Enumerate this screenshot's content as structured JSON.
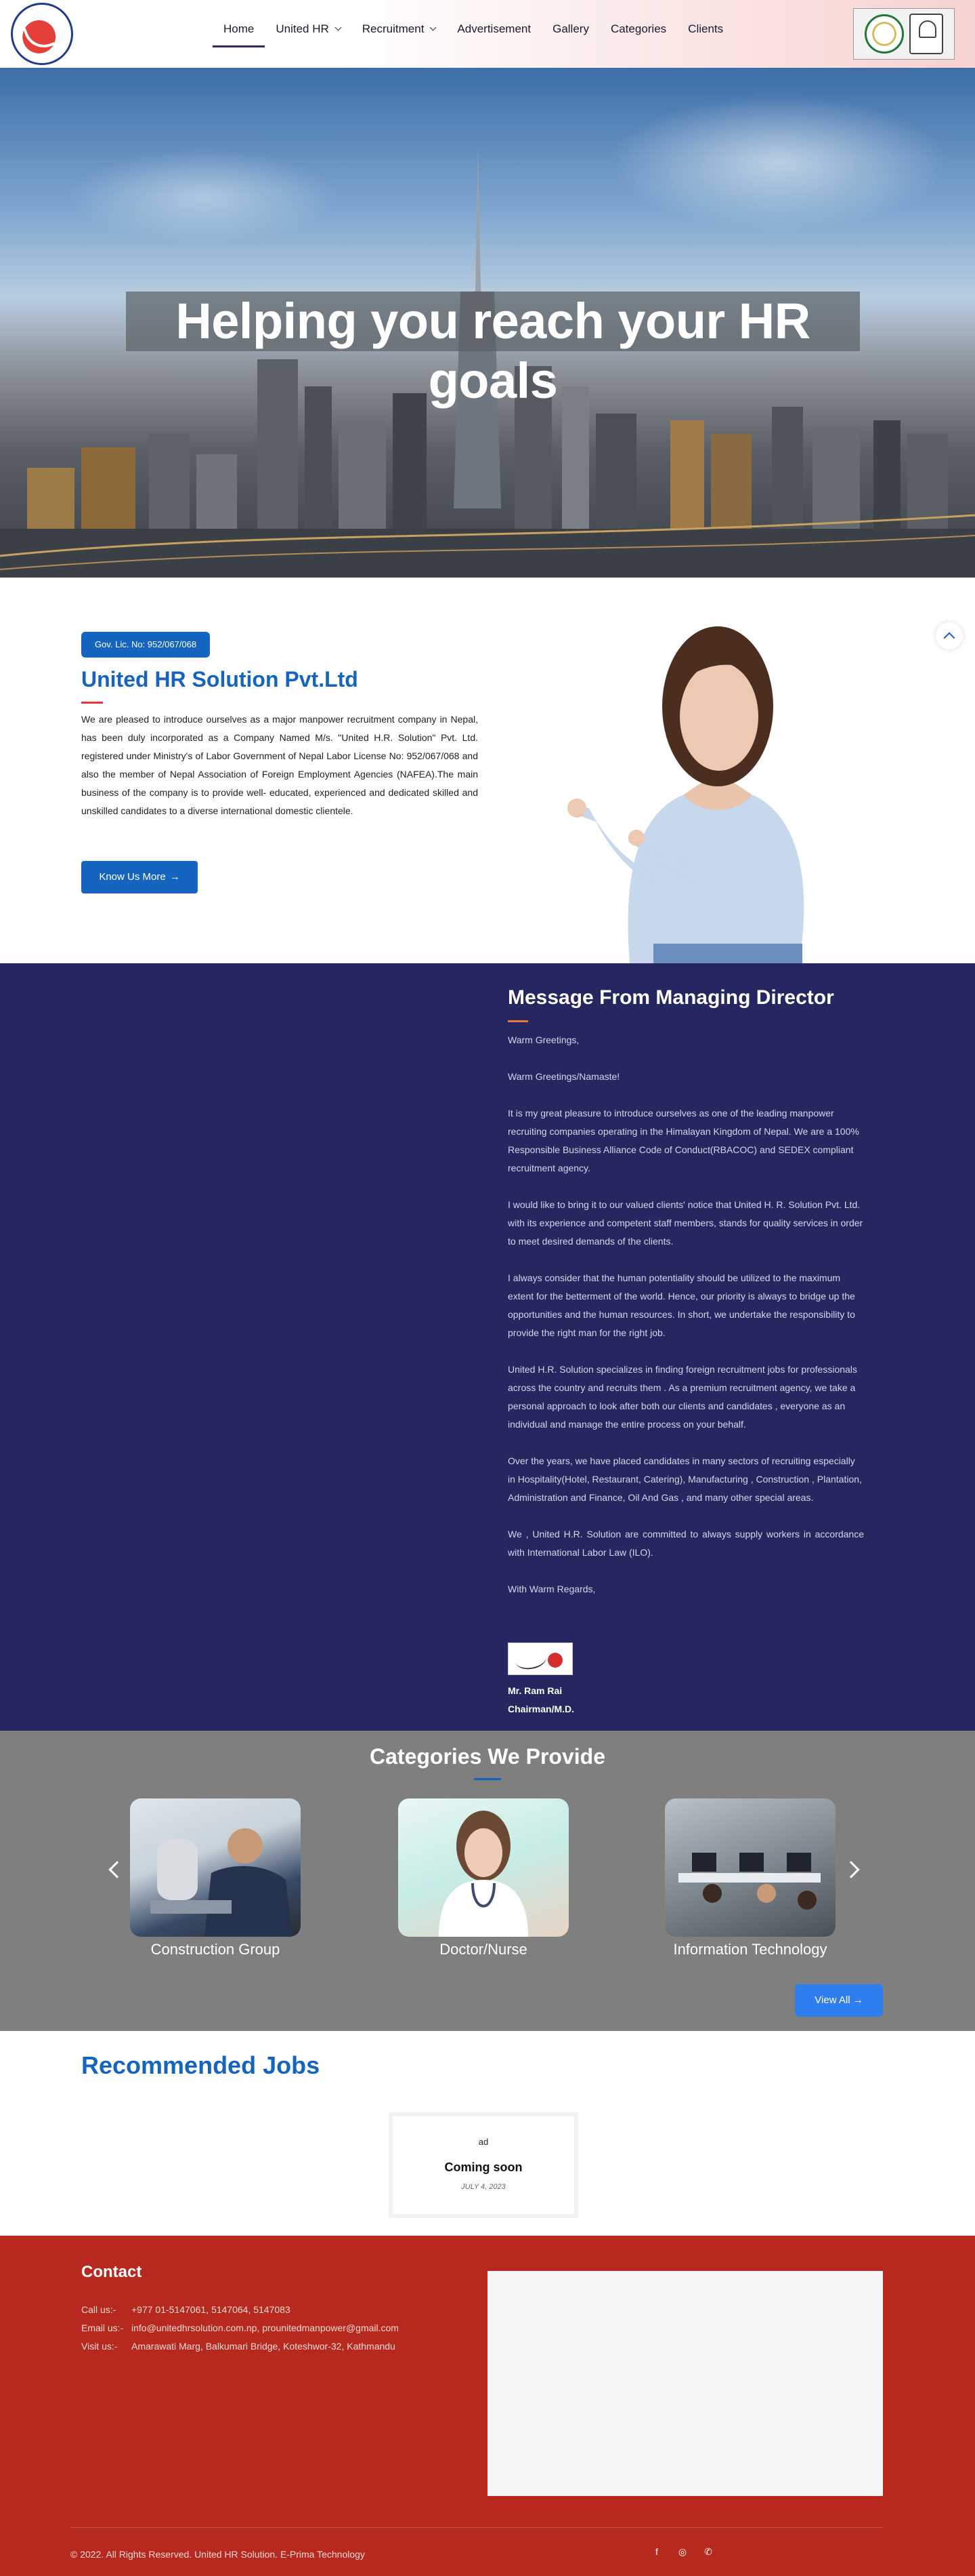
{
  "nav": {
    "items": [
      {
        "label": "Home",
        "active": true,
        "dropdown": false
      },
      {
        "label": "United HR",
        "active": false,
        "dropdown": true
      },
      {
        "label": "Recruitment",
        "active": false,
        "dropdown": true
      },
      {
        "label": "Advertisement",
        "active": false,
        "dropdown": false
      },
      {
        "label": "Gallery",
        "active": false,
        "dropdown": false
      },
      {
        "label": "Categories",
        "active": false,
        "dropdown": false
      },
      {
        "label": "Clients",
        "active": false,
        "dropdown": false
      }
    ]
  },
  "hero": {
    "title": "Helping you reach your HR goals"
  },
  "about": {
    "license_badge": "Gov. Lic. No: 952/067/068",
    "title": "United HR Solution Pvt.Ltd",
    "text": "We are pleased to introduce ourselves as a major manpower recruitment company in Nepal, has been duly incorporated as a Company Named M/s. \"United H.R. Solution\" Pvt. Ltd. registered under Ministry's of Labor Government of Nepal Labor License No: 952/067/068 and also the member of Nepal Association of Foreign Employment Agencies (NAFEA).The main business of the company is to provide well- educated, experienced and dedicated skilled and unskilled candidates to a diverse international domestic clientele.",
    "button_label": "Know Us More"
  },
  "message": {
    "title": "Message From Managing Director",
    "paragraphs": [
      "Warm Greetings,",
      "Warm Greetings/Namaste!",
      "It is my great pleasure to introduce ourselves  as one of the leading manpower recruiting companies operating in the Himalayan Kingdom of Nepal. We are a 100% Responsible Business Alliance Code of Conduct(RBACOC) and SEDEX compliant recruitment agency.",
      "I would like to bring it to our valued clients' notice that United H. R. Solution Pvt. Ltd. with its experience and competent staff members, stands for quality services in order to meet desired demands of the clients.",
      "I always consider that the human potentiality should be utilized to the maximum extent for the betterment of the world. Hence, our priority is always to bridge up the opportunities and the human resources. In short, we undertake the responsibility to provide the right man for the right job.",
      "United H.R. Solution specializes in finding foreign recruitment jobs for professionals across the country and recruits them . As a premium recruitment agency, we take a personal approach to look after both our clients and candidates , everyone as an individual and manage the entire process on your behalf.",
      "Over the years, we have placed candidates in many sectors of recruiting especially in Hospitality(Hotel, Restaurant, Catering), Manufacturing , Construction , Plantation, Administration and Finance, Oil And Gas , and many other special areas.",
      "We , United H.R. Solution are committed to always supply workers in accordance with International Labor Law (ILO).",
      "With Warm Regards,"
    ],
    "signer_name": "Mr. Ram Rai",
    "signer_role": "Chairman/M.D."
  },
  "categories": {
    "title": "Categories We Provide",
    "items": [
      {
        "label": "Construction Group"
      },
      {
        "label": "Doctor/Nurse"
      },
      {
        "label": "Information Technology"
      }
    ],
    "view_all_label": "View All"
  },
  "jobs": {
    "title": "Recommended Jobs",
    "card": {
      "ad": "ad",
      "title": "Coming soon",
      "date": "JULY 4, 2023"
    }
  },
  "footer": {
    "contact_title": "Contact",
    "call_label": "Call us:-",
    "call_value": "+977 01-5147061, 5147064, 5147083",
    "email_label": "Email us:-",
    "email_value": "info@unitedhrsolution.com.np, prounitedmanpower@gmail.com",
    "visit_label": "Visit us:-",
    "visit_value": "Amarawati Marg, Balkumari Bridge, Koteshwor-32, Kathmandu",
    "copyright": "© 2022. All Rights Reserved. United HR Solution. E-Prima Technology",
    "socials": [
      "facebook-icon",
      "instagram-icon",
      "whatsapp-icon"
    ]
  },
  "colors": {
    "brand_blue": "#1565c0",
    "message_bg": "#262760",
    "categories_bg": "#7f7f7f",
    "footer_bg": "#b7291f",
    "view_all_blue": "#2f7ef0"
  }
}
